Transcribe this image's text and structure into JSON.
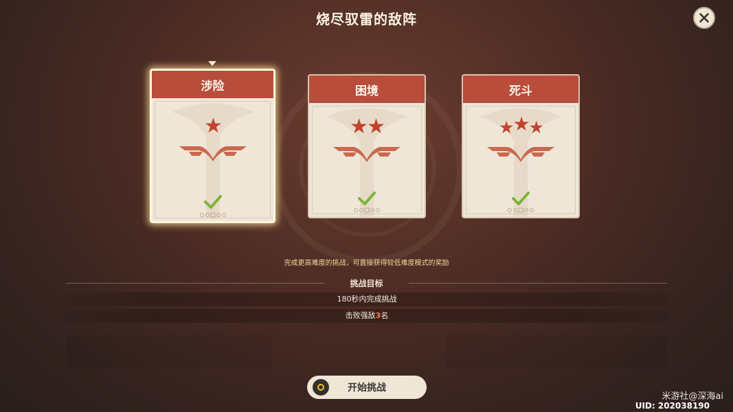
{
  "title": "烧尽驭雷的敌阵",
  "difficulties": [
    {
      "label": "涉险",
      "stars": 1,
      "completed": true,
      "selected": true
    },
    {
      "label": "困境",
      "stars": 2,
      "completed": true,
      "selected": false
    },
    {
      "label": "死斗",
      "stars": 3,
      "completed": true,
      "selected": false
    }
  ],
  "hint": "完成更高难度的挑战，可直接获得较低难度模式的奖励",
  "objectives": {
    "title": "挑战目标",
    "items": [
      {
        "text": "180秒内完成挑战"
      },
      {
        "prefix": "击败强敌",
        "highlight": "3",
        "suffix": "名"
      }
    ]
  },
  "start_button": {
    "label": "开始挑战"
  },
  "watermark": "米游社@深海ai",
  "uid": "UID: 202038190",
  "colors": {
    "card_header": "#b84d3b",
    "star": "#c0452f",
    "check": "#7fb43a",
    "hint_text": "#f0d99a",
    "highlight": "#ff7a52"
  },
  "icons": {
    "close": "close-icon",
    "star": "star-icon",
    "check": "check-icon",
    "controller_button": "controller-button-icon"
  }
}
